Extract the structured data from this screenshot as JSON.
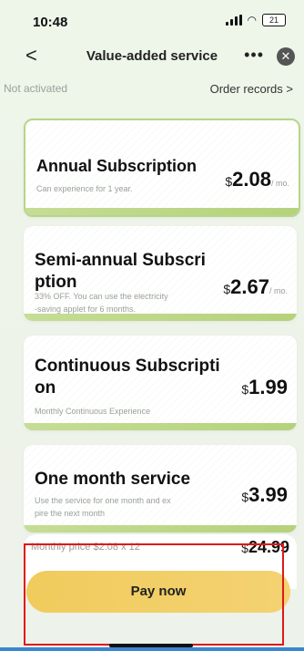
{
  "status_bar": {
    "time": "10:48",
    "battery": "21"
  },
  "nav": {
    "back": "<",
    "title": "Value-added service",
    "more": "•••",
    "close": "✕"
  },
  "subbar": {
    "status": "Not activated",
    "orders": "Order records >"
  },
  "plans": [
    {
      "title": "Annual Subscription",
      "desc": "Can experience for 1 year.",
      "currency": "$",
      "amount": "2.08",
      "per": "/ mo."
    },
    {
      "title": "Semi-annual Subscri\nption",
      "desc": "33% OFF. You can use the electricity\n-saving applet for 6 months.",
      "currency": "$",
      "amount": "2.67",
      "per": "/ mo."
    },
    {
      "title": "Continuous Subscripti\non",
      "desc": "Monthly Continuous Experience",
      "currency": "$",
      "amount": "1.99",
      "per": ""
    },
    {
      "title": "One month service",
      "desc": "Use the service for one month and ex\npire the next month",
      "currency": "$",
      "amount": "3.99",
      "per": ""
    }
  ],
  "total": {
    "label": "Monthly price $2.08 x 12",
    "currency": "$",
    "amount": "24.99"
  },
  "pay_button": "Pay now"
}
